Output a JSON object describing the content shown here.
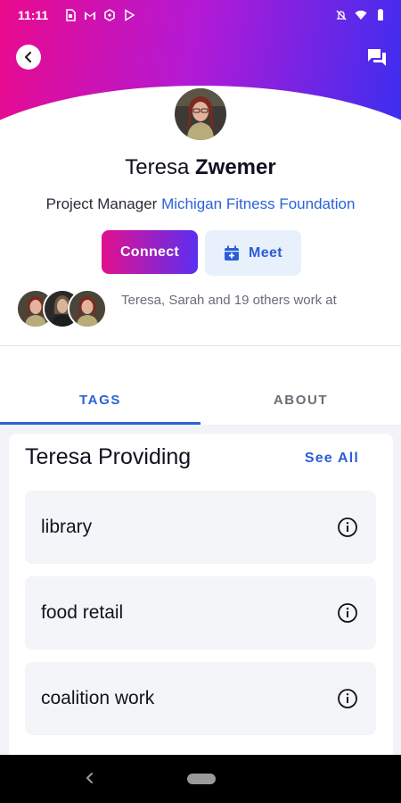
{
  "status_bar": {
    "time": "11:11",
    "left_icons": [
      "sim-icon",
      "gmail-icon",
      "app-hex-icon",
      "play-store-icon"
    ],
    "right_icons": [
      "notifications-muted-icon",
      "wifi-icon",
      "battery-icon"
    ]
  },
  "header": {
    "back_icon": "back-arrow-icon",
    "chat_icon": "chat-icon",
    "gradient_start": "#ea0a8c",
    "gradient_end": "#3b2ef0"
  },
  "profile": {
    "first_name": "Teresa",
    "last_name": "Zwemer",
    "role": "Project Manager",
    "organization": "Michigan Fitness Foundation",
    "connect_label": "Connect",
    "meet_label": "Meet",
    "coworkers_text": "Teresa, Sarah and 19 others work at"
  },
  "tabs": [
    {
      "label": "TAGS",
      "active": true
    },
    {
      "label": "ABOUT",
      "active": false
    }
  ],
  "providing": {
    "title": "Teresa Providing",
    "see_all_label": "See All",
    "tags": [
      {
        "label": "library"
      },
      {
        "label": "food retail"
      },
      {
        "label": "coalition work"
      }
    ]
  },
  "colors": {
    "accent": "#2a62d8",
    "meet_bg": "#e8f0fb",
    "card_item_bg": "#f4f5f8"
  }
}
